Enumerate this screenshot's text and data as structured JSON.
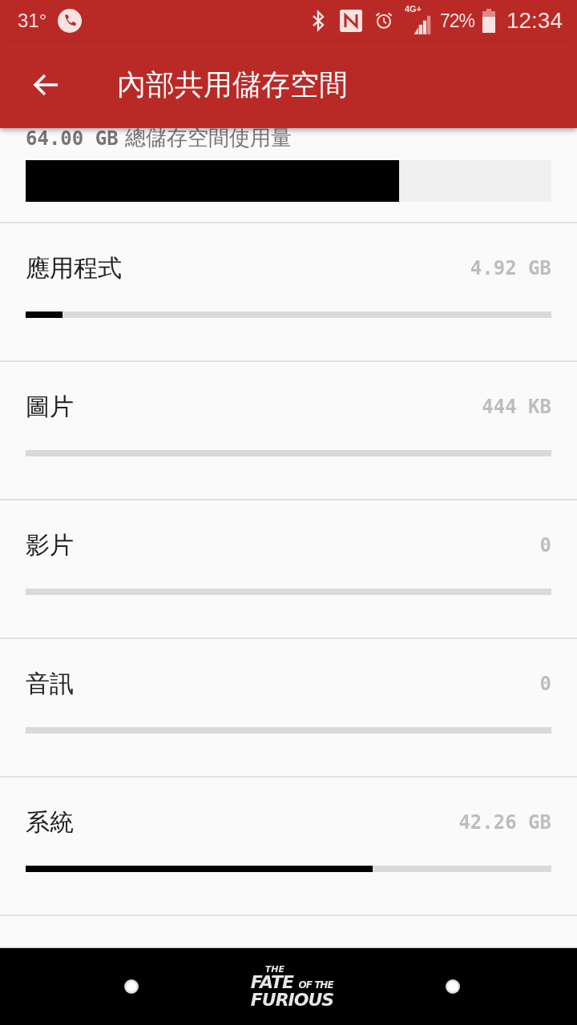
{
  "status_bar": {
    "temperature": "31°",
    "network": "4G+",
    "battery": "72%",
    "time": "12:34"
  },
  "toolbar": {
    "title": "內部共用儲存空間"
  },
  "summary": {
    "size": "64.00 GB",
    "label": "總儲存空間使用量",
    "level": 0.71
  },
  "categories": [
    {
      "name": "應用程式",
      "size": "4.92 GB",
      "level": 0.07
    },
    {
      "name": "圖片",
      "size": "444 KB",
      "level": 0
    },
    {
      "name": "影片",
      "size": "0",
      "level": 0
    },
    {
      "name": "音訊",
      "size": "0",
      "level": 0
    },
    {
      "name": "系統",
      "size": "42.26 GB",
      "level": 0.66
    }
  ],
  "nav_bar": {
    "logo": {
      "top": "THE",
      "main": "FATE",
      "small": "OF THE",
      "bottom": "FURIOUS"
    }
  }
}
